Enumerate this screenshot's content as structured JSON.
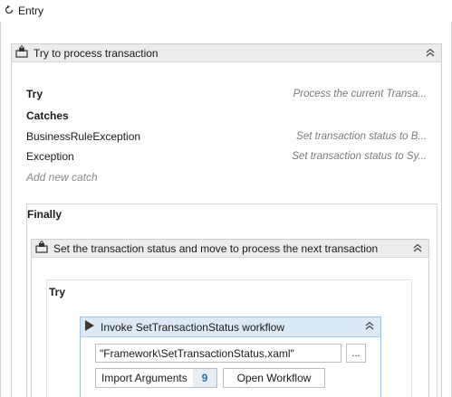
{
  "entry": {
    "label": "Entry",
    "icon": "entry-arrow-icon"
  },
  "try_catch": {
    "title": "Try to process transaction",
    "try": {
      "label": "Try",
      "hint": "Process the current Transa..."
    },
    "catches_label": "Catches",
    "catches": [
      {
        "name": "BusinessRuleException",
        "hint": "Set transaction status to B..."
      },
      {
        "name": "Exception",
        "hint": "Set transaction status to Sy..."
      }
    ],
    "add_catch": "Add new catch",
    "finally_label": "Finally"
  },
  "inner_sequence": {
    "title": "Set the transaction status and move to process the next transaction",
    "try_label": "Try"
  },
  "invoke": {
    "title": "Invoke SetTransactionStatus workflow",
    "path_value": "\"Framework\\SetTransactionStatus.xaml\"",
    "browse_label": "...",
    "import_label": "Import Arguments",
    "import_count": "9",
    "open_label": "Open Workflow"
  },
  "colors": {
    "header_gray": "#ececec",
    "invoke_header": "#dce9f6",
    "invoke_border": "#9fc3e7",
    "count_blue": "#2b6cb0"
  }
}
